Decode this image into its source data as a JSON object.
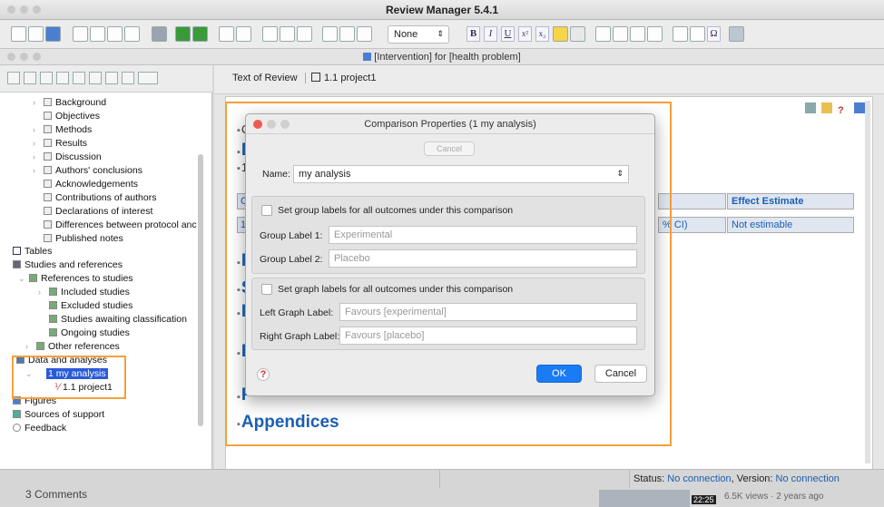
{
  "app": {
    "title": "Review Manager 5.4.1",
    "doc_title": "[Intervention] for [health problem]"
  },
  "toolbar": {
    "style_select": "None",
    "style_chevron": "⇕",
    "bold": "B",
    "italic": "I",
    "underline": "U",
    "superscript": "x²",
    "subscript": "x₂",
    "omega": "Ω"
  },
  "tree": {
    "items": [
      {
        "label": "Background"
      },
      {
        "label": "Objectives"
      },
      {
        "label": "Methods"
      },
      {
        "label": "Results"
      },
      {
        "label": "Discussion"
      },
      {
        "label": "Authors' conclusions"
      },
      {
        "label": "Acknowledgements"
      },
      {
        "label": "Contributions of authors"
      },
      {
        "label": "Declarations of interest"
      },
      {
        "label": "Differences between protocol anc"
      },
      {
        "label": "Published notes"
      },
      {
        "label": "Tables"
      },
      {
        "label": "Studies and references"
      },
      {
        "label": "References to studies"
      },
      {
        "label": "Included studies"
      },
      {
        "label": "Excluded studies"
      },
      {
        "label": "Studies awaiting classification"
      },
      {
        "label": "Ongoing studies"
      },
      {
        "label": "Other references"
      },
      {
        "label": "Data and analyses"
      },
      {
        "label": "1 my analysis"
      },
      {
        "label": "1.1 project1"
      },
      {
        "label": "Figures"
      },
      {
        "label": "Sources of support"
      },
      {
        "label": "Feedback"
      }
    ]
  },
  "tabs": {
    "text_of_review": "Text of Review",
    "project_tab": "1.1 project1"
  },
  "document": {
    "appendices": "Appendices",
    "col_effect": "Effect Estimate",
    "cell_ci": "% CI)",
    "cell_estimate": "Not estimable",
    "frag_o": "O",
    "frag_1": "1.",
    "sec_marker": "D",
    "frag_c": "C",
    "frag_d": "D",
    "frag_1b": "1",
    "frag_f": "F",
    "frag_s": "S",
    "frag_i": "I",
    "frag_e": "E",
    "frag_f2": "F"
  },
  "dialog": {
    "title": "Comparison Properties (1 my analysis)",
    "cancel_top": "Cancel",
    "name_label": "Name:",
    "name_value": "my analysis",
    "name_chevron": "⇕",
    "group_check_label": "Set group labels for all outcomes under this comparison",
    "group1_label": "Group Label 1:",
    "group1_value": "Experimental",
    "group2_label": "Group Label 2:",
    "group2_value": "Placebo",
    "graph_check_label": "Set graph labels for all outcomes under this comparison",
    "left_graph_label": "Left Graph Label:",
    "left_graph_value": "Favours [experimental]",
    "right_graph_label": "Right Graph Label:",
    "right_graph_value": "Favours [placebo]",
    "ok": "OK",
    "cancel": "Cancel",
    "help": "?"
  },
  "status": {
    "prefix": "Status: ",
    "conn": "No connection",
    "version_prefix": ", Version: ",
    "version": "No connection",
    "comments": "3 Comments",
    "views": "6.5K views · 2 years ago",
    "duration": "22:25"
  },
  "colors": {
    "accent": "#2a5ad8",
    "highlight_box": "#f5a03a",
    "link": "#1a5fb4"
  }
}
